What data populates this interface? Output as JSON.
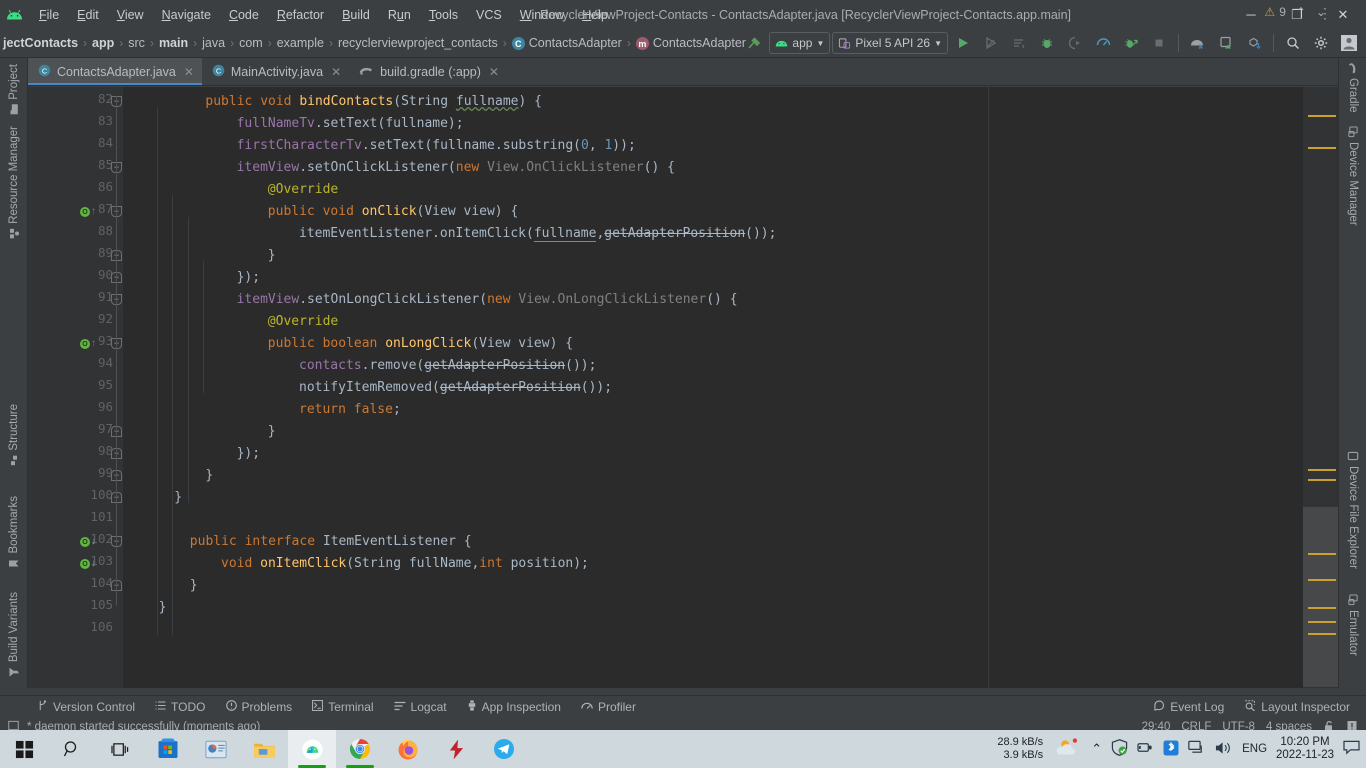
{
  "window": {
    "title": "RecyclerViewProject-Contacts - ContactsAdapter.java [RecyclerViewProject-Contacts.app.main]",
    "minimize": "─",
    "maximize": "❐",
    "close": "✕"
  },
  "menu": [
    {
      "label": "File"
    },
    {
      "label": "Edit"
    },
    {
      "label": "View"
    },
    {
      "label": "Navigate"
    },
    {
      "label": "Code"
    },
    {
      "label": "Refactor"
    },
    {
      "label": "Build"
    },
    {
      "label": "Run"
    },
    {
      "label": "Tools"
    },
    {
      "label": "VCS"
    },
    {
      "label": "Window"
    },
    {
      "label": "Help"
    }
  ],
  "breadcrumbs": [
    {
      "label": "jectContacts",
      "bold": true,
      "icon": ""
    },
    {
      "label": "app",
      "bold": true,
      "icon": ""
    },
    {
      "label": "src",
      "bold": false,
      "icon": ""
    },
    {
      "label": "main",
      "bold": true,
      "icon": ""
    },
    {
      "label": "java",
      "bold": false,
      "icon": ""
    },
    {
      "label": "com",
      "bold": false,
      "icon": ""
    },
    {
      "label": "example",
      "bold": false,
      "icon": ""
    },
    {
      "label": "recyclerviewproject_contacts",
      "bold": false,
      "icon": ""
    },
    {
      "label": "ContactsAdapter",
      "bold": false,
      "icon": "class"
    },
    {
      "label": "ContactsAdapter",
      "bold": false,
      "icon": "method"
    }
  ],
  "toolbar": {
    "build_hammer": "build-icon",
    "module_selector": "app",
    "device_selector": "Pixel 5 API 26",
    "run_label": "run-icon",
    "apply_changes": "apply-changes-icon",
    "run_with_coverage": "coverage-icon",
    "debug_label": "debug-icon",
    "attach_debugger": "attach-debugger-icon",
    "profiler": "profiler-icon",
    "profile_app": "profile-app-icon",
    "stop": "stop-icon",
    "avd_manager": "avd-manager-icon",
    "sdk_manager": "sdk-manager-icon",
    "sync_gradle": "sync-gradle-icon",
    "search": "search-icon",
    "settings": "gear-icon",
    "account": "account-icon"
  },
  "editor_tabs": [
    {
      "label": "ContactsAdapter.java",
      "icon": "class",
      "active": true,
      "close": "✕"
    },
    {
      "label": "MainActivity.java",
      "icon": "class",
      "active": false,
      "close": "✕"
    },
    {
      "label": "build.gradle (:app)",
      "icon": "gradle",
      "active": false,
      "close": "✕"
    }
  ],
  "tabs_overflow": "⋮",
  "left_tools": [
    {
      "label": "Project",
      "icon": "folder-icon"
    },
    {
      "label": "Resource Manager",
      "icon": "resource-icon"
    },
    {
      "label": "Structure",
      "icon": "structure-icon"
    },
    {
      "label": "Bookmarks",
      "icon": "bookmark-icon"
    },
    {
      "label": "Build Variants",
      "icon": "build-variants-icon"
    }
  ],
  "right_tools": [
    {
      "label": "Gradle",
      "icon": "gradle-icon"
    },
    {
      "label": "Device Manager",
      "icon": "device-manager-icon"
    },
    {
      "label": "Device File Explorer",
      "icon": "device-file-explorer-icon"
    },
    {
      "label": "Emulator",
      "icon": "emulator-icon"
    }
  ],
  "inspection": {
    "warning_glyph": "⚠",
    "warning_count": "9",
    "prev": "⌃",
    "next": "⌄"
  },
  "code": {
    "first_line": 82,
    "lines": [
      {
        "n": 82,
        "indent": 4,
        "html": "<span class=\"k\">public</span> <span class=\"k\">void</span> <span class=\"m\">bindContacts</span><span class=\"t\">(String </span><span class=\"squig\">fullname</span><span class=\"t\">) {</span>",
        "fold": "open",
        "gutter": null
      },
      {
        "n": 83,
        "indent": 6,
        "html": "<span class=\"f\">fullNameTv</span><span class=\"t\">.setText(fullname);</span>",
        "fold": null,
        "gutter": null
      },
      {
        "n": 84,
        "indent": 6,
        "html": "<span class=\"f\">firstCharacterTv</span><span class=\"t\">.setText(fullname.substring(</span><span class=\"n\">0</span><span class=\"t\">, </span><span class=\"n\">1</span><span class=\"t\">));</span>",
        "fold": null,
        "gutter": null
      },
      {
        "n": 85,
        "indent": 6,
        "html": "<span class=\"f\">itemView</span><span class=\"t\">.setOnClickListener(</span><span class=\"k\">new</span> <span class=\"g\">View.OnClickListener</span><span class=\"t\">() {</span>",
        "fold": "open",
        "gutter": null
      },
      {
        "n": 86,
        "indent": 8,
        "html": "<span class=\"a\">@Override</span>",
        "fold": null,
        "gutter": null
      },
      {
        "n": 87,
        "indent": 8,
        "html": "<span class=\"k\">public</span> <span class=\"k\">void</span> <span class=\"m\">onClick</span><span class=\"t\">(View view) {</span>",
        "fold": "open",
        "gutter": "override"
      },
      {
        "n": 88,
        "indent": 10,
        "html": "<span class=\"t\">itemEventListener.onItemClick(</span><span class=\"param-u\">fullname</span><span class=\"t\">,</span><span class=\"dep\">getAdapterPosition</span><span class=\"t\">());</span>",
        "fold": null,
        "gutter": null
      },
      {
        "n": 89,
        "indent": 8,
        "html": "<span class=\"t\">}</span>",
        "fold": "close",
        "gutter": null
      },
      {
        "n": 90,
        "indent": 6,
        "html": "<span class=\"t\">});</span>",
        "fold": "close",
        "gutter": null
      },
      {
        "n": 91,
        "indent": 6,
        "html": "<span class=\"f\">itemView</span><span class=\"t\">.setOnLongClickListener(</span><span class=\"k\">new</span> <span class=\"g\">View.OnLongClickListener</span><span class=\"t\">() {</span>",
        "fold": "open",
        "gutter": null
      },
      {
        "n": 92,
        "indent": 8,
        "html": "<span class=\"a\">@Override</span>",
        "fold": null,
        "gutter": null
      },
      {
        "n": 93,
        "indent": 8,
        "html": "<span class=\"k\">public</span> <span class=\"k\">boolean</span> <span class=\"m\">onLongClick</span><span class=\"t\">(View view) {</span>",
        "fold": "open",
        "gutter": "override"
      },
      {
        "n": 94,
        "indent": 10,
        "html": "<span class=\"f\">contacts</span><span class=\"t\">.remove(</span><span class=\"dep\">getAdapterPosition</span><span class=\"t\">());</span>",
        "fold": null,
        "gutter": null
      },
      {
        "n": 95,
        "indent": 10,
        "html": "<span class=\"t\">notifyItemRemoved(</span><span class=\"dep\">getAdapterPosition</span><span class=\"t\">());</span>",
        "fold": null,
        "gutter": null
      },
      {
        "n": 96,
        "indent": 10,
        "html": "<span class=\"k\">return</span> <span class=\"k\">false</span><span class=\"t\">;</span>",
        "fold": null,
        "gutter": null
      },
      {
        "n": 97,
        "indent": 8,
        "html": "<span class=\"t\">}</span>",
        "fold": "close",
        "gutter": null
      },
      {
        "n": 98,
        "indent": 6,
        "html": "<span class=\"t\">});</span>",
        "fold": "close",
        "gutter": null
      },
      {
        "n": 99,
        "indent": 4,
        "html": "<span class=\"t\">}</span>",
        "fold": "close",
        "gutter": null
      },
      {
        "n": 100,
        "indent": 2,
        "html": "<span class=\"t\">}</span>",
        "fold": "close",
        "gutter": null
      },
      {
        "n": 101,
        "indent": 0,
        "html": "",
        "fold": null,
        "gutter": null
      },
      {
        "n": 102,
        "indent": 3,
        "html": "<span class=\"k\">public</span> <span class=\"k\">interface</span> <span class=\"t\">ItemEventListener {</span>",
        "fold": "open",
        "gutter": "impl"
      },
      {
        "n": 103,
        "indent": 5,
        "html": "<span class=\"k\">void</span> <span class=\"m\">onItemClick</span><span class=\"t\">(String fullName,</span><span class=\"k\">int</span><span class=\"t\"> position);</span>",
        "fold": null,
        "gutter": "impl"
      },
      {
        "n": 104,
        "indent": 3,
        "html": "<span class=\"t\">}</span>",
        "fold": "close",
        "gutter": null
      },
      {
        "n": 105,
        "indent": 1,
        "html": "<span class=\"t\">}</span>",
        "fold": null,
        "gutter": null
      },
      {
        "n": 106,
        "indent": 0,
        "html": "",
        "fold": null,
        "gutter": null
      }
    ]
  },
  "bottom_tools": [
    {
      "label": "Version Control",
      "icon": "branch-icon"
    },
    {
      "label": "TODO",
      "icon": "todo-icon"
    },
    {
      "label": "Problems",
      "icon": "problems-icon"
    },
    {
      "label": "Terminal",
      "icon": "terminal-icon"
    },
    {
      "label": "Logcat",
      "icon": "logcat-icon"
    },
    {
      "label": "App Inspection",
      "icon": "app-inspection-icon"
    },
    {
      "label": "Profiler",
      "icon": "profiler-icon"
    }
  ],
  "bottom_right_tools": [
    {
      "label": "Event Log",
      "icon": "event-log-icon"
    },
    {
      "label": "Layout Inspector",
      "icon": "layout-inspector-icon"
    }
  ],
  "status": {
    "message": "* daemon started successfully (moments ago)",
    "caret": "29:40",
    "line_sep": "CRLF",
    "encoding": "UTF-8",
    "indent": "4 spaces",
    "lock": "lock-icon",
    "notifications": "notification-icon"
  },
  "taskbar": {
    "items": [
      {
        "name": "start-button",
        "icon": "windows-logo"
      },
      {
        "name": "search-button",
        "icon": "magnifier"
      },
      {
        "name": "task-view-button",
        "icon": "task-view"
      },
      {
        "name": "microsoft-store",
        "icon": "store"
      },
      {
        "name": "powerpoint",
        "icon": "ppt"
      },
      {
        "name": "file-explorer",
        "icon": "folder"
      },
      {
        "name": "android-studio",
        "icon": "android-studio"
      },
      {
        "name": "google-chrome",
        "icon": "chrome"
      },
      {
        "name": "firefox",
        "icon": "firefox"
      },
      {
        "name": "flash-app",
        "icon": "bolt"
      },
      {
        "name": "telegram",
        "icon": "telegram"
      }
    ],
    "net_down": "28.9 kB/s",
    "net_up": "3.9 kB/s",
    "weather": "weather-icon",
    "chevron": "⌃",
    "tray_icons": [
      "shield-icon",
      "usb-icon",
      "bluetooth-icon",
      "network-icon",
      "volume-icon"
    ],
    "language": "ENG",
    "time": "10:20 PM",
    "date": "2022-11-23",
    "action_center": "notification-center-icon"
  },
  "colors": {
    "accent": "#4a88c7",
    "warning": "#c9a032",
    "green": "#62b543",
    "editor_bg": "#2b2b2b",
    "chrome_bg": "#3c3f41"
  }
}
